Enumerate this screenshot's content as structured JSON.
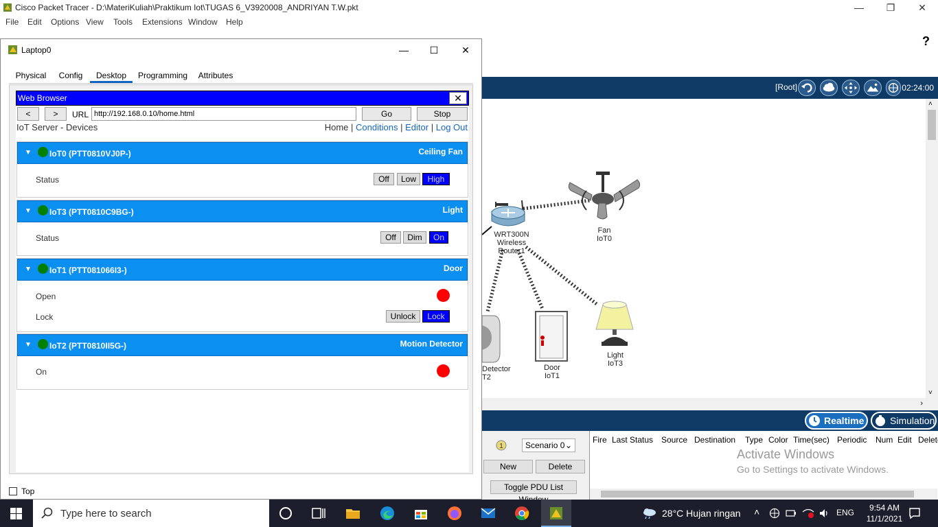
{
  "app": {
    "title": "Cisco Packet Tracer - D:\\MateriKuliah\\Praktikum Iot\\TUGAS 6_V3920008_ANDRIYAN T.W.pkt",
    "menu": [
      "File",
      "Edit",
      "Options",
      "View",
      "Tools",
      "Extensions",
      "Window",
      "Help"
    ],
    "help_glyph": "?"
  },
  "workspace": {
    "root_label": "[Root]",
    "clock": "02:24:00",
    "realtime_label": "Realtime",
    "simulation_label": "Simulation"
  },
  "network": {
    "router": {
      "line1": "WRT300N",
      "line2": "Wireless Router1"
    },
    "fan": {
      "line1": "Fan",
      "line2": "IoT0"
    },
    "motion": {
      "line1": "Detector",
      "line2": "T2"
    },
    "door": {
      "line1": "Door",
      "line2": "IoT1"
    },
    "light": {
      "line1": "Light",
      "line2": "IoT3"
    }
  },
  "pdu_panel": {
    "scenario": "Scenario 0",
    "new_label": "New",
    "delete_label": "Delete",
    "toggle_label": "Toggle PDU List Window",
    "columns": [
      "Fire",
      "Last Status",
      "Source",
      "Destination",
      "Type",
      "Color",
      "Time(sec)",
      "Periodic",
      "Num",
      "Edit",
      "Delete"
    ],
    "watermark_line1": "Activate Windows",
    "watermark_line2": "Go to Settings to activate Windows."
  },
  "laptop": {
    "title": "Laptop0",
    "tabs": [
      "Physical",
      "Config",
      "Desktop",
      "Programming",
      "Attributes"
    ],
    "active_tab": "Desktop",
    "top_checkbox_label": "Top"
  },
  "browser": {
    "title": "Web Browser",
    "close_glyph": "✕",
    "back_glyph": "<",
    "forward_glyph": ">",
    "url_label": "URL",
    "url_value": "http://192.168.0.10/home.html",
    "go_label": "Go",
    "stop_label": "Stop"
  },
  "iot_page": {
    "title": "IoT Server - Devices",
    "nav": {
      "home": "Home",
      "conditions": "Conditions",
      "editor": "Editor",
      "logout": "Log Out",
      "sep": "|"
    },
    "devices": [
      {
        "name": "IoT0 (PTT0810VJ0P-)",
        "type": "Ceiling Fan",
        "rows": [
          {
            "label": "Status",
            "options": [
              "Off",
              "Low",
              "High"
            ],
            "selected": "High"
          }
        ]
      },
      {
        "name": "IoT3 (PTT0810C9BG-)",
        "type": "Light",
        "rows": [
          {
            "label": "Status",
            "options": [
              "Off",
              "Dim",
              "On"
            ],
            "selected": "On"
          }
        ]
      },
      {
        "name": "IoT1 (PTT081066I3-)",
        "type": "Door",
        "rows": [
          {
            "label": "Open",
            "indicator": "#ff0000"
          },
          {
            "label": "Lock",
            "options": [
              "Unlock",
              "Lock"
            ],
            "selected": "Lock"
          }
        ]
      },
      {
        "name": "IoT2 (PTT0810II5G-)",
        "type": "Motion Detector",
        "rows": [
          {
            "label": "On",
            "indicator": "#ff0000"
          }
        ]
      }
    ],
    "chevron": "▼"
  },
  "taskbar": {
    "search_placeholder": "Type here to search",
    "weather": "28°C  Hujan ringan",
    "language": "ENG",
    "time": "9:54 AM",
    "date": "11/1/2021"
  },
  "colors": {
    "accent_blue": "#0000ff",
    "device_header": "#0b8ff0",
    "online_green": "#008000",
    "indicator_red": "#ff0000",
    "pt_navy": "#0f3a66"
  }
}
